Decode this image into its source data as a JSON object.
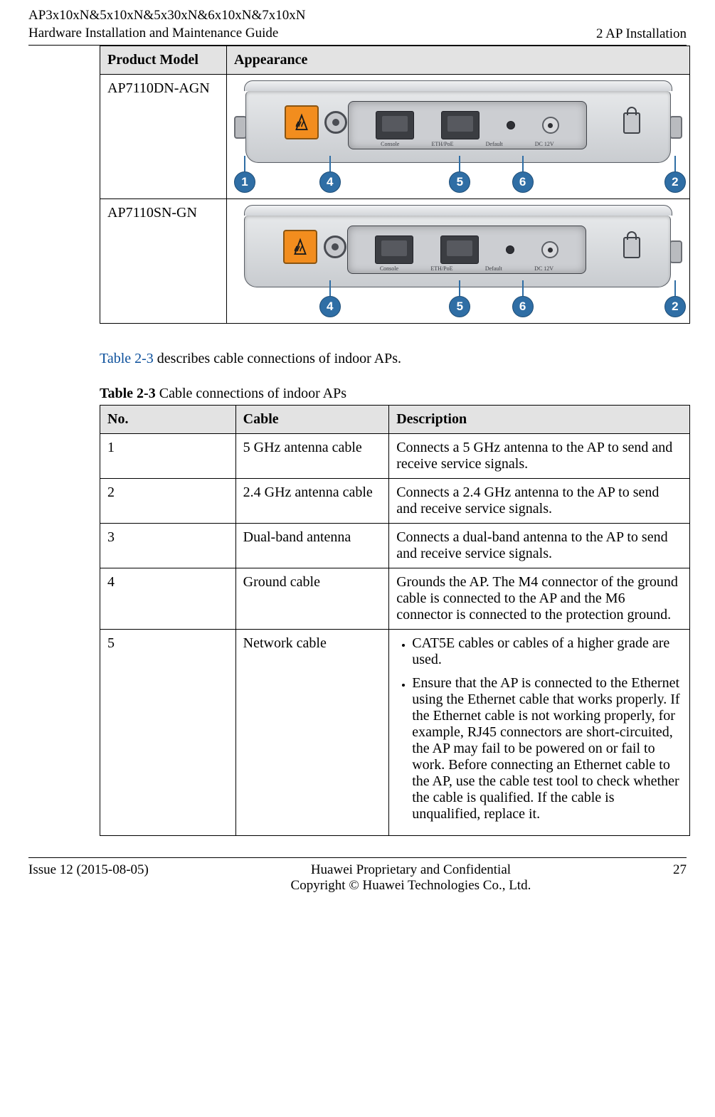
{
  "header": {
    "line1": "AP3x10xN&5x10xN&5x30xN&6x10xN&7x10xN",
    "line2": "Hardware Installation and Maintenance Guide",
    "right": "2 AP Installation"
  },
  "table1": {
    "headers": {
      "c1": "Product Model",
      "c2": "Appearance"
    },
    "rows": [
      {
        "model": "AP7110DN-AGN"
      },
      {
        "model": "AP7110SN-GN"
      }
    ]
  },
  "panel_labels": {
    "l1": "Console",
    "l2": "ETH/PoE",
    "l3": "Default",
    "l4": "DC 12V"
  },
  "callouts": {
    "n1": "1",
    "n2": "2",
    "n4": "4",
    "n5": "5",
    "n6": "6"
  },
  "paragraph": {
    "pre": "",
    "link": "Table 2-3",
    "post": " describes cable connections of indoor APs."
  },
  "table2_caption": {
    "bold": "Table 2-3",
    "rest": " Cable connections of indoor APs"
  },
  "table2": {
    "headers": {
      "c1": "No.",
      "c2": "Cable",
      "c3": "Description"
    },
    "rows": [
      {
        "n": "1",
        "cable": "5 GHz antenna cable",
        "desc": "Connects a 5 GHz antenna to the AP to send and receive service signals."
      },
      {
        "n": "2",
        "cable": "2.4 GHz antenna cable",
        "desc": "Connects a 2.4 GHz antenna to the AP to send and receive service signals."
      },
      {
        "n": "3",
        "cable": "Dual-band antenna",
        "desc": "Connects a dual-band antenna to the AP to send and receive service signals."
      },
      {
        "n": "4",
        "cable": "Ground cable",
        "desc": "Grounds the AP. The M4 connector of the ground cable is connected to the AP and the M6 connector is connected to the protection ground."
      },
      {
        "n": "5",
        "cable": "Network cable",
        "bullets": [
          "CAT5E cables or cables of a higher grade are used.",
          "Ensure that the AP is connected to the Ethernet using the Ethernet cable that works properly. If the Ethernet cable is not working properly, for example, RJ45 connectors are short-circuited, the AP may fail to be powered on or fail to work. Before connecting an Ethernet cable to the AP, use the cable test tool to check whether the cable is qualified. If the cable is unqualified, replace it."
        ]
      }
    ]
  },
  "footer": {
    "left": "Issue 12 (2015-08-05)",
    "center1": "Huawei Proprietary and Confidential",
    "center2": "Copyright © Huawei Technologies Co., Ltd.",
    "right": "27"
  }
}
